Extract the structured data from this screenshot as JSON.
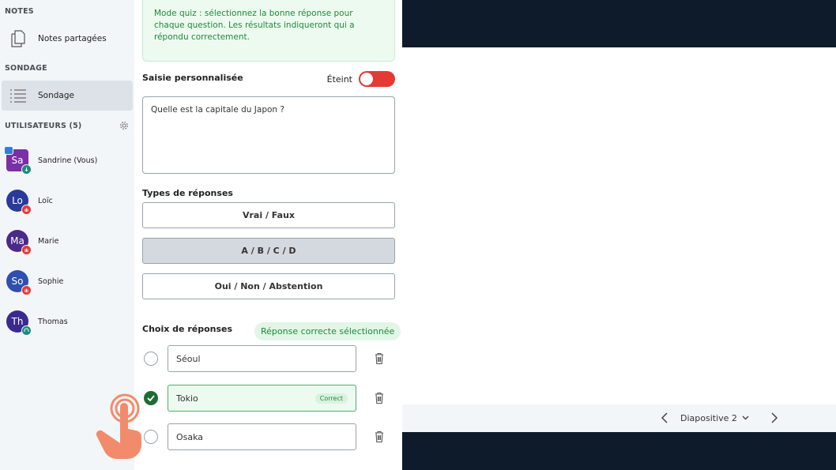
{
  "sidebar": {
    "notes_section": "NOTES",
    "shared_notes": "Notes partagées",
    "poll_section": "SONDAGE",
    "poll_item": "Sondage",
    "users_section": "UTILISATEURS (5)",
    "users": [
      {
        "initials": "Sa",
        "name": "Sandrine (Vous)",
        "color": "#7b2fa6"
      },
      {
        "initials": "Lo",
        "name": "Loïc",
        "color": "#2a3a9a"
      },
      {
        "initials": "Ma",
        "name": "Marie",
        "color": "#4a2a8a"
      },
      {
        "initials": "So",
        "name": "Sophie",
        "color": "#2f4fb0"
      },
      {
        "initials": "Th",
        "name": "Thomas",
        "color": "#3a2a90"
      }
    ]
  },
  "panel": {
    "quiz_note": "Mode quiz : sélectionnez la bonne réponse pour chaque question. Les résultats indiqueront qui a répondu correctement.",
    "custom_input_label": "Saisie personnalisée",
    "toggle_state": "Éteint",
    "question": "Quelle est la capitale du Japon ?",
    "response_types_label": "Types de réponses",
    "response_types": [
      "Vrai / Faux",
      "A / B / C / D",
      "Oui / Non / Abstention"
    ],
    "choices_label": "Choix de réponses",
    "correct_selected": "Réponse correcte sélectionnée",
    "answers": [
      {
        "text": "Séoul",
        "correct": false
      },
      {
        "text": "Tokio",
        "correct": true,
        "tag": "Correct"
      },
      {
        "text": "Osaka",
        "correct": false
      }
    ]
  },
  "presentation": {
    "slide_label": "Diapositive 2"
  },
  "colors": {
    "accent_green": "#1f8a3b",
    "toggle_off": "#e53935",
    "touch_hint": "#f28b6b"
  }
}
